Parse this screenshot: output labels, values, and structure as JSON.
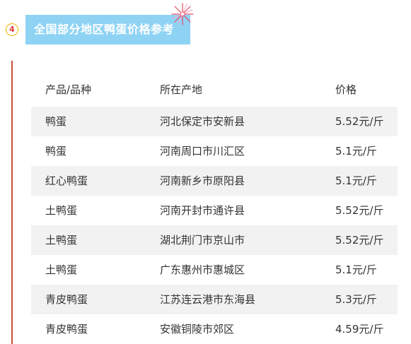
{
  "section": {
    "number": "4",
    "title": "全国部分地区鸭蛋价格参考"
  },
  "table": {
    "headers": [
      "产品/品种",
      "所在产地",
      "价格"
    ],
    "rows": [
      [
        "鸭蛋",
        "河北保定市安新县",
        "5.52元/斤"
      ],
      [
        "鸭蛋",
        "河南周口市川汇区",
        "5.1元/斤"
      ],
      [
        "红心鸭蛋",
        "河南新乡市原阳县",
        "5.1元/斤"
      ],
      [
        "土鸭蛋",
        "河南开封市通许县",
        "5.52元/斤"
      ],
      [
        "土鸭蛋",
        "湖北荆门市京山市",
        "5.52元/斤"
      ],
      [
        "土鸭蛋",
        "广东惠州市惠城区",
        "5.1元/斤"
      ],
      [
        "青皮鸭蛋",
        "江苏连云港市东海县",
        "5.3元/斤"
      ],
      [
        "青皮鸭蛋",
        "安徽铜陵市郊区",
        "4.59元/斤"
      ]
    ]
  },
  "colors": {
    "title_bg": "#8fd3f4",
    "accent_line": "#c94b3b",
    "badge_border": "#f2b705",
    "row_shade": "#f2f2f2"
  },
  "icons": {
    "decoration": "firework-icon"
  }
}
